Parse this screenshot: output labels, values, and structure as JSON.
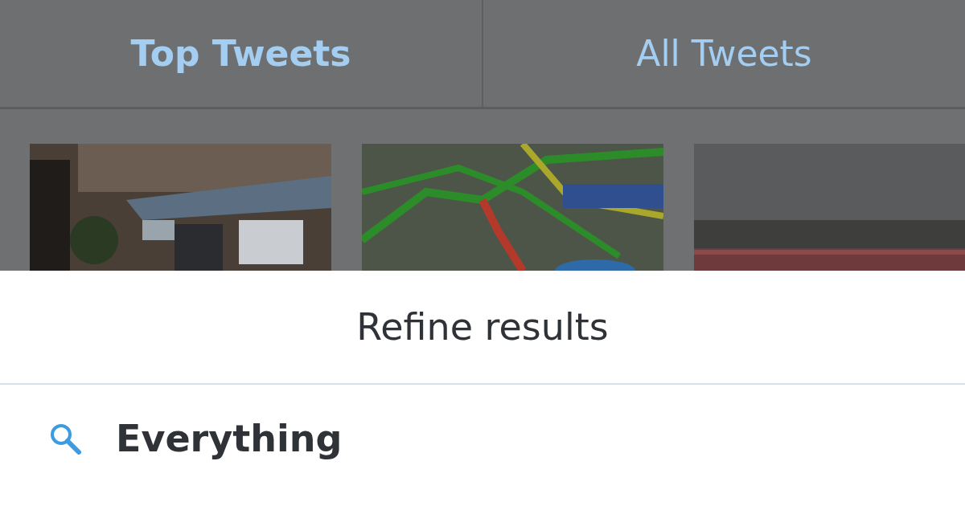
{
  "tabs": [
    {
      "label": "Top Tweets",
      "selected": true
    },
    {
      "label": "All Tweets",
      "selected": false
    }
  ],
  "sheet": {
    "title": "Refine results",
    "options": [
      {
        "label": "Everything"
      }
    ]
  }
}
